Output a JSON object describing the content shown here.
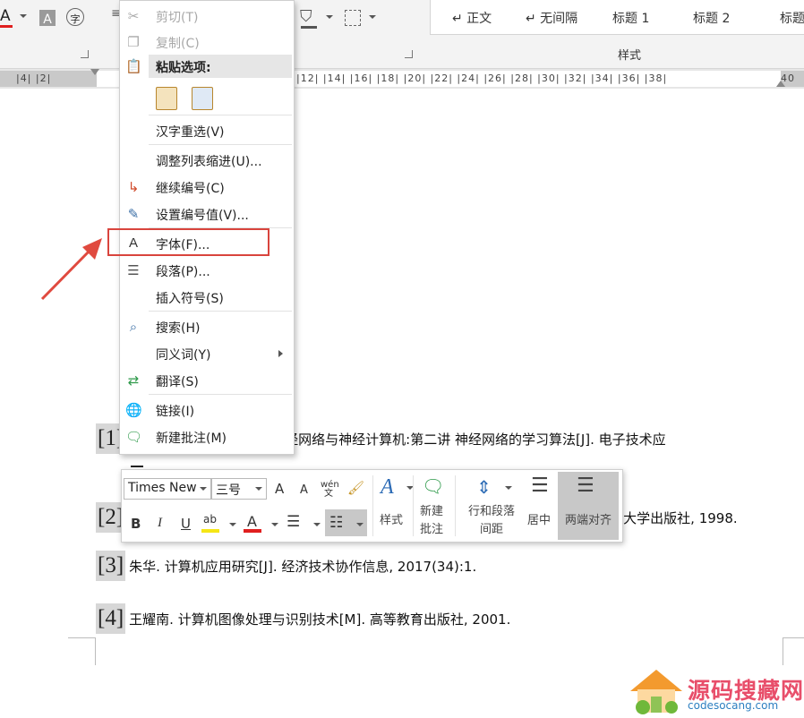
{
  "ribbon": {
    "font_color_glyph": "A",
    "shade_glyph": "A",
    "circle_char": "字",
    "styles": [
      "↵ 正文",
      "↵ 无间隔",
      "标题 1",
      "标题 2",
      "标题"
    ],
    "styles_group_label": "样式"
  },
  "ruler": {
    "left_marks": "|4|  |2|",
    "marks": "|12|  |14|  |16|  |18|  |20|  |22|  |24|  |26|  |28|  |30|  |32|  |34|  |36|  |38|",
    "right_mark": "40"
  },
  "context_menu": {
    "cut": "剪切(T)",
    "copy": "复制(C)",
    "paste_options": "粘贴选项:",
    "reconvert": "汉字重选(V)",
    "adjust_indent": "调整列表缩进(U)...",
    "continue_numbering": "继续编号(C)",
    "set_number_value": "设置编号值(V)...",
    "font": "字体(F)...",
    "paragraph": "段落(P)...",
    "insert_symbol": "插入符号(S)",
    "search": "搜索(H)",
    "synonyms": "同义词(Y)",
    "translate": "翻译(S)",
    "link": "链接(I)",
    "new_comment": "新建批注(M)"
  },
  "document": {
    "references": [
      {
        "num": "[1]",
        "text": "经网络与神经计算机:第二讲  神经网络的学习算法[J]. 电子技术应"
      },
      {
        "num": "[2]",
        "text": "大学出版社, 1998."
      },
      {
        "num": "[3]",
        "text": "朱华. 计算机应用研究[J]. 经济技术协作信息, 2017(34):1."
      },
      {
        "num": "[4]",
        "text": "王耀南. 计算机图像处理与识别技术[M]. 高等教育出版社, 2001."
      }
    ]
  },
  "mini_toolbar": {
    "font_name": "Times New",
    "font_size": "三号",
    "grow_font": "A",
    "shrink_font": "A",
    "phonetic": "wén文",
    "bold": "B",
    "italic": "I",
    "underline": "U",
    "highlight": "ab",
    "font_color": "A",
    "styles_label": "样式",
    "new_comment_line1": "新建",
    "new_comment_line2": "批注",
    "line_spacing_line1": "行和段落",
    "line_spacing_line2": "间距",
    "center_label": "居中",
    "justify_label": "两端对齐"
  },
  "watermark": {
    "text": "源码搜藏网",
    "url": "codesocang.com"
  },
  "colors": {
    "highlight_box": "#d9443d",
    "arrow": "#e04a3f",
    "font_color_bar": "#e01f1f",
    "highlight_bar": "#f5e616"
  }
}
